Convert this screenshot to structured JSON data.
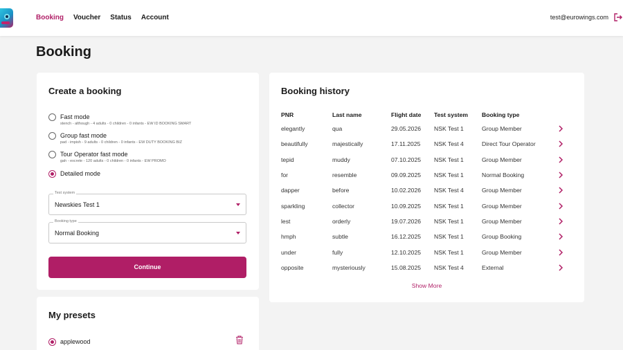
{
  "header": {
    "nav": [
      "Booking",
      "Voucher",
      "Status",
      "Account"
    ],
    "active": "Booking",
    "email": "test@eurowings.com"
  },
  "page": {
    "title": "Booking"
  },
  "create": {
    "title": "Create a booking",
    "modes": [
      {
        "label": "Fast mode",
        "desc": "stench - although - 4 adults - 0 children - 0 infants - EW ID BOOKING SMART",
        "checked": false
      },
      {
        "label": "Group fast mode",
        "desc": "pad - impish - 9 adults - 0 children - 0 infants - EW DUTY BOOKING BIZ",
        "checked": false
      },
      {
        "label": "Tour Operator fast mode",
        "desc": "gah - excrete - 120 adults - 0 children - 0 infants - EW PROMO",
        "checked": false
      },
      {
        "label": "Detailed mode",
        "desc": "",
        "checked": true
      }
    ],
    "test_system": {
      "legend": "Test system",
      "value": "Newskies Test 1"
    },
    "booking_type": {
      "legend": "Booking type",
      "value": "Normal Booking"
    },
    "continue_label": "Continue"
  },
  "presets": {
    "title": "My presets",
    "items": [
      {
        "label": "applewood",
        "checked": true
      }
    ]
  },
  "history": {
    "title": "Booking history",
    "columns": [
      "PNR",
      "Last name",
      "Flight date",
      "Test system",
      "Booking type"
    ],
    "rows": [
      [
        "elegantly",
        "qua",
        "29.05.2026",
        "NSK Test 1",
        "Group Member"
      ],
      [
        "beautifully",
        "majestically",
        "17.11.2025",
        "NSK Test 4",
        "Direct Tour Operator"
      ],
      [
        "tepid",
        "muddy",
        "07.10.2025",
        "NSK Test 1",
        "Group Member"
      ],
      [
        "for",
        "resemble",
        "09.09.2025",
        "NSK Test 1",
        "Normal Booking"
      ],
      [
        "dapper",
        "before",
        "10.02.2026",
        "NSK Test 4",
        "Group Member"
      ],
      [
        "sparkling",
        "collector",
        "10.09.2025",
        "NSK Test 1",
        "Group Member"
      ],
      [
        "lest",
        "orderly",
        "19.07.2026",
        "NSK Test 1",
        "Group Member"
      ],
      [
        "hmph",
        "subtle",
        "16.12.2025",
        "NSK Test 1",
        "Group Booking"
      ],
      [
        "under",
        "fully",
        "12.10.2025",
        "NSK Test 1",
        "Group Member"
      ],
      [
        "opposite",
        "mysteriously",
        "15.08.2025",
        "NSK Test 4",
        "External"
      ]
    ],
    "show_more": "Show More"
  },
  "colors": {
    "accent": "#b01e66",
    "background": "#f3f3f3",
    "card": "#ffffff"
  },
  "icons": {
    "logo": "eurowings-logo",
    "logout": "logout-icon",
    "row_action": "chevron-right-icon",
    "delete": "trash-icon"
  }
}
